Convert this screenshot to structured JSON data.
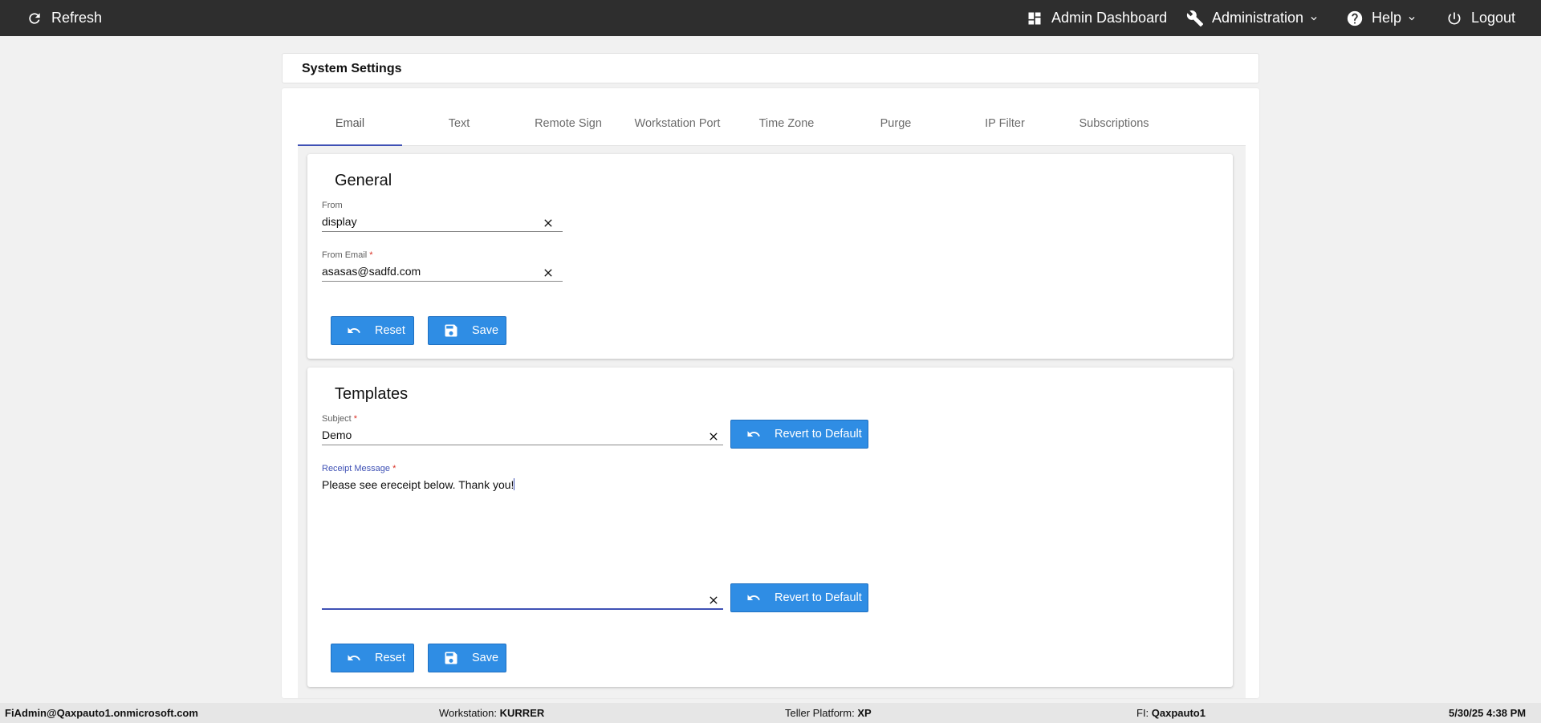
{
  "topbar": {
    "refresh_label": "Refresh",
    "admin_dashboard_label": "Admin Dashboard",
    "administration_label": "Administration",
    "help_label": "Help",
    "logout_label": "Logout",
    "icons": [
      "refresh-icon",
      "dashboard-icon",
      "wrench-icon",
      "help-circle-icon",
      "power-icon",
      "chevron-down-icon"
    ]
  },
  "page": {
    "title": "System Settings"
  },
  "tabs": [
    {
      "label": "Email",
      "active": true
    },
    {
      "label": "Text"
    },
    {
      "label": "Remote Sign"
    },
    {
      "label": "Workstation Port"
    },
    {
      "label": "Time Zone"
    },
    {
      "label": "Purge"
    },
    {
      "label": "IP Filter"
    },
    {
      "label": "Subscriptions"
    }
  ],
  "general": {
    "title": "General",
    "from": {
      "label": "From",
      "value": "display"
    },
    "from_email": {
      "label": "From Email",
      "required_mark": "*",
      "value": "asasas@sadfd.com"
    },
    "reset_label": "Reset",
    "save_label": "Save"
  },
  "templates": {
    "title": "Templates",
    "subject": {
      "label": "Subject",
      "required_mark": "*",
      "value": "Demo"
    },
    "receipt_message": {
      "label": "Receipt Message",
      "required_mark": "*",
      "value": "Please see ereceipt below. Thank you!"
    },
    "revert_label": "Revert to Default",
    "reset_label": "Reset",
    "save_label": "Save"
  },
  "footer": {
    "user": "FiAdmin@Qaxpauto1.onmicrosoft.com",
    "workstation_label": "Workstation:",
    "workstation_value": "KURRER",
    "teller_label": "Teller Platform:",
    "teller_value": "XP",
    "fi_label": "FI:",
    "fi_value": "Qaxpauto1",
    "datetime": "5/30/25 4:38 PM"
  },
  "colors": {
    "topbar": "#2e2e2e",
    "accent": "#3f51b5",
    "button": "#2f8de4",
    "background": "#f1f1f1"
  }
}
